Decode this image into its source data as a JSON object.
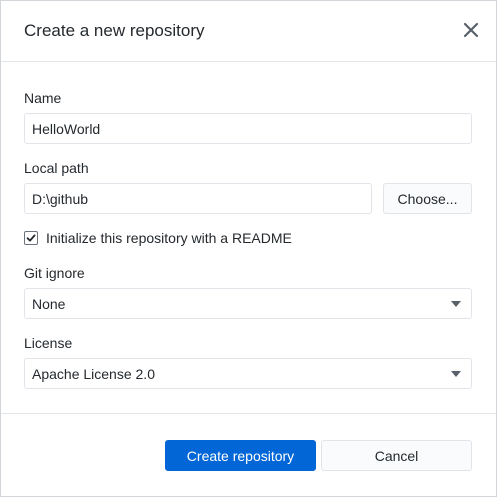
{
  "dialog": {
    "title": "Create a new repository",
    "close_icon": "close-icon"
  },
  "form": {
    "name": {
      "label": "Name",
      "value": "HelloWorld"
    },
    "local_path": {
      "label": "Local path",
      "value": "D:\\github",
      "choose_label": "Choose..."
    },
    "readme": {
      "label": "Initialize this repository with a README",
      "checked": true
    },
    "git_ignore": {
      "label": "Git ignore",
      "selected": "None"
    },
    "license": {
      "label": "License",
      "selected": "Apache License 2.0"
    }
  },
  "footer": {
    "create_label": "Create repository",
    "cancel_label": "Cancel"
  },
  "colors": {
    "primary": "#0366d6",
    "border": "#e1e4e8",
    "text": "#24292e"
  }
}
